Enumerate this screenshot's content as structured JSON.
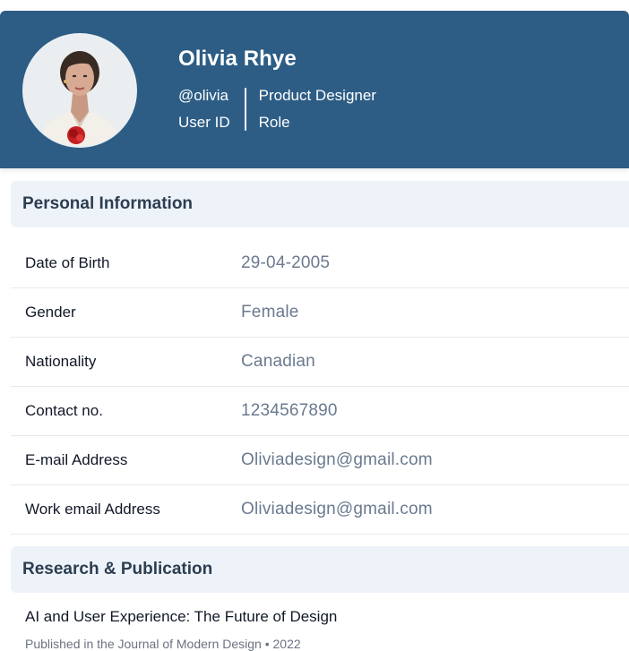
{
  "profile": {
    "name": "Olivia Rhye",
    "user_id_value": "@olivia",
    "user_id_label": "User ID",
    "role_value": "Product Designer",
    "role_label": "Role",
    "avatar_icon": "profile-photo"
  },
  "personal_info": {
    "title": "Personal Information",
    "rows": [
      {
        "label": "Date of Birth",
        "value": "29-04-2005"
      },
      {
        "label": "Gender",
        "value": "Female"
      },
      {
        "label": "Nationality",
        "value": "Canadian"
      },
      {
        "label": "Contact no.",
        "value": "1234567890"
      },
      {
        "label": "E-mail Address",
        "value": "Oliviadesign@gmail.com"
      },
      {
        "label": "Work email Address",
        "value": "Oliviadesign@gmail.com"
      }
    ]
  },
  "research": {
    "title": "Research & Publication",
    "items": [
      {
        "title": "AI and User Experience: The Future of Design",
        "meta": "Published in the Journal of Modern Design • 2022"
      }
    ]
  },
  "colors": {
    "header_bg": "#2d5d85",
    "section_bg": "#eef3fa",
    "value_text": "#6b7a8f"
  }
}
